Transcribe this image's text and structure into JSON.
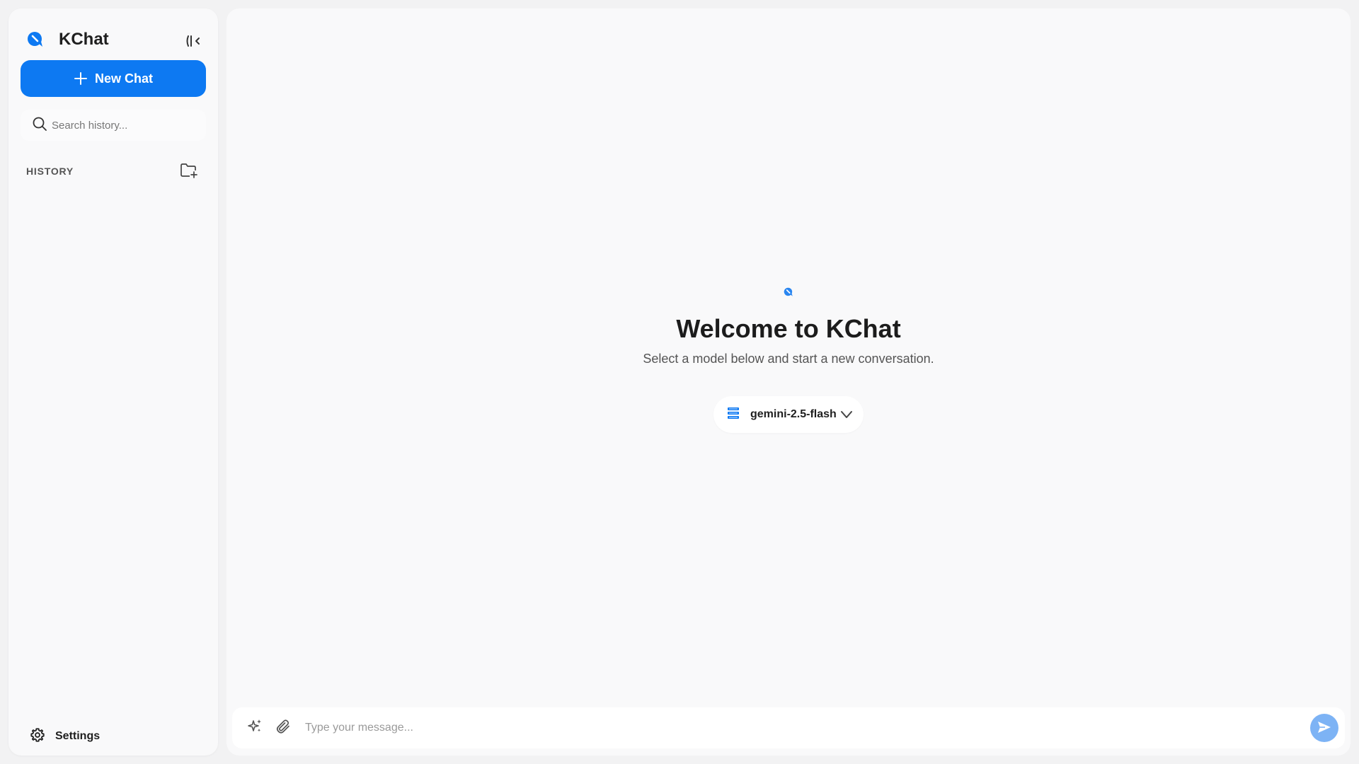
{
  "app": {
    "name": "KChat",
    "accent_color": "#0d79f2",
    "icons": {
      "logo": "chat-bubble-logo-icon",
      "collapse": "sidebar-collapse-icon",
      "search": "search-icon",
      "new_folder": "folder-plus-icon",
      "settings": "gear-icon",
      "model": "server-stack-icon",
      "chevron": "chevron-down-icon",
      "sparkle": "sparkle-icon",
      "attach": "paperclip-icon",
      "send": "send-icon"
    }
  },
  "sidebar": {
    "new_chat_label": "New Chat",
    "search_placeholder": "Search history...",
    "history_label": "HISTORY",
    "settings_label": "Settings"
  },
  "main": {
    "welcome_title": "Welcome to KChat",
    "welcome_subtitle": "Select a model below and start a new conversation.",
    "selected_model": "gemini-2.5-flash"
  },
  "composer": {
    "placeholder": "Type your message...",
    "send_button_color": "#7db3f5"
  }
}
